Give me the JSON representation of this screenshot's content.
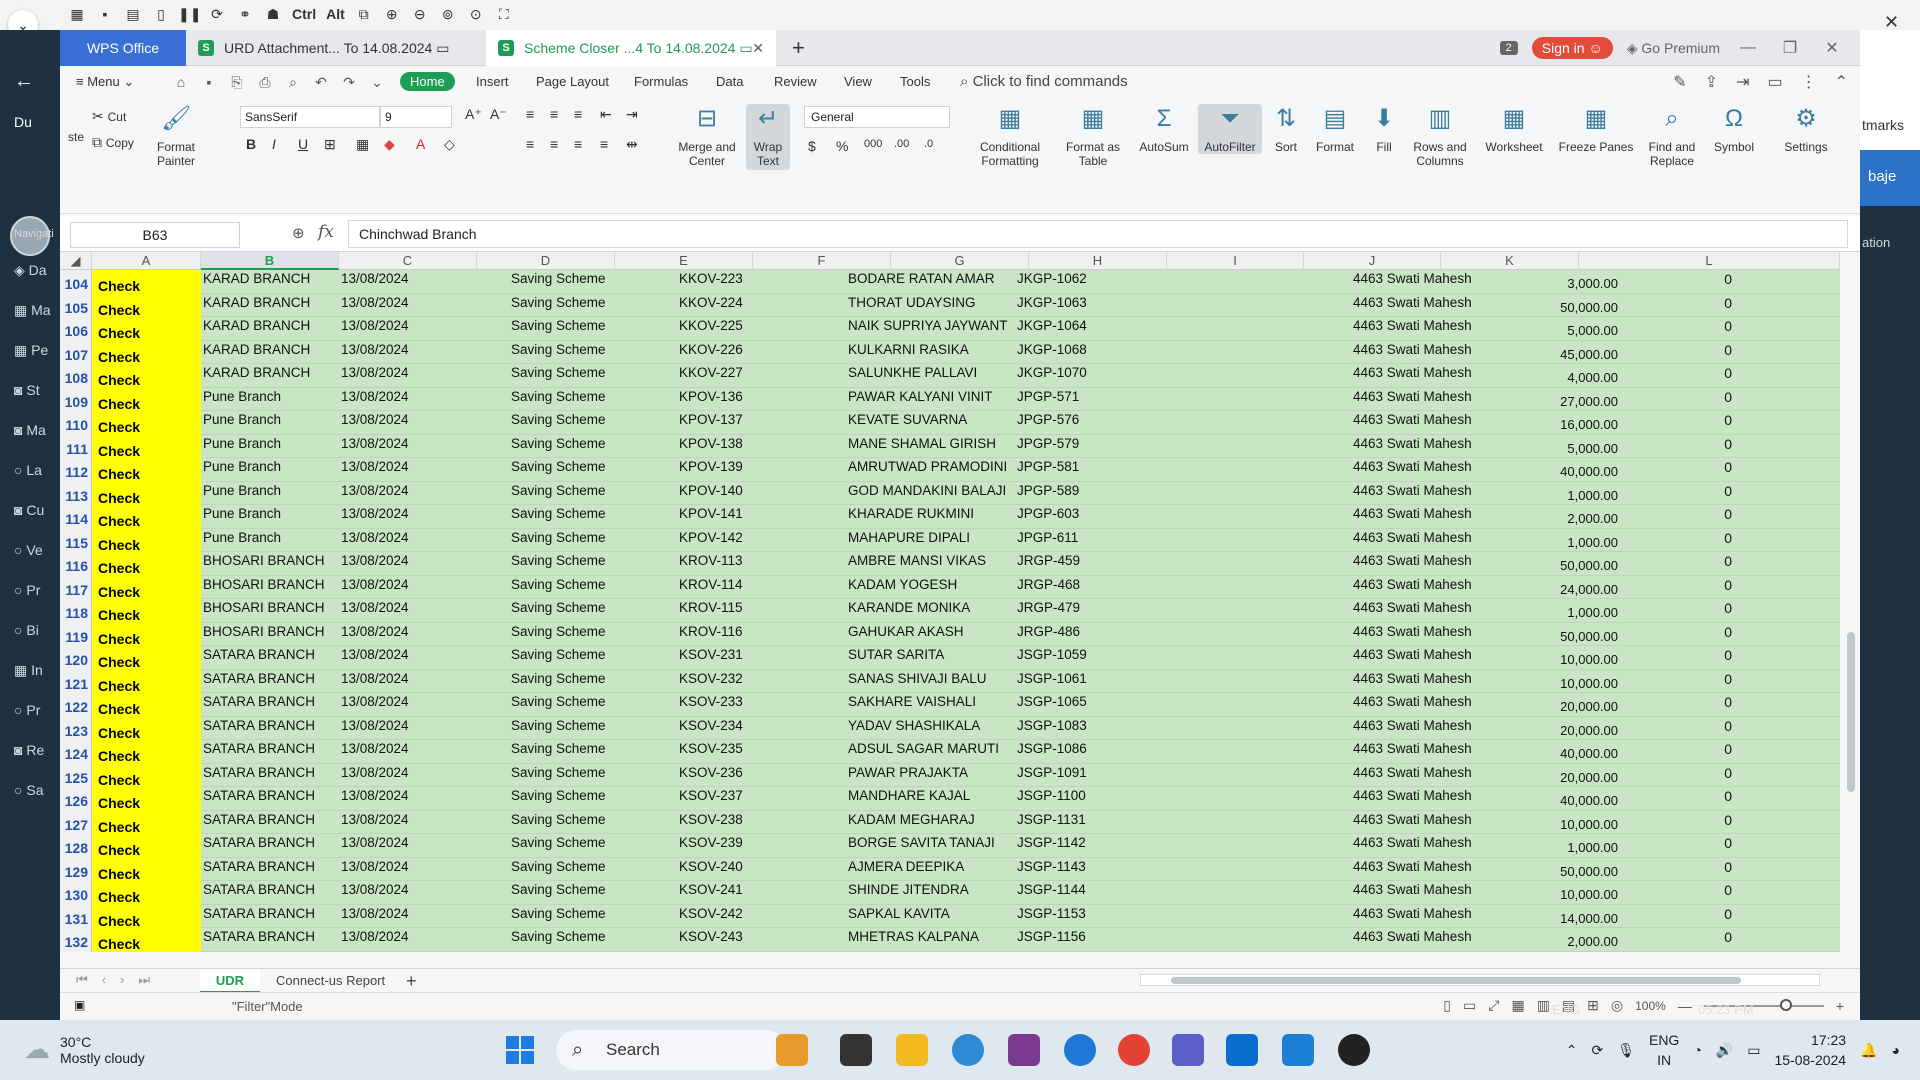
{
  "remote_toolbar": {
    "ctrl_label": "Ctrl",
    "alt_label": "Alt"
  },
  "app": {
    "wps_tab": "WPS Office",
    "doc_tabs": [
      {
        "label": "URD Attachment... To 14.08.2024",
        "icon": "S"
      },
      {
        "label": "Scheme  Closer ...4 To 14.08.2024",
        "icon": "S"
      }
    ],
    "badge_count": "2",
    "sign_in": "Sign in",
    "go_premium": "Go Premium"
  },
  "menu": {
    "menu_label": "Menu",
    "tabs": [
      "Home",
      "Insert",
      "Page Layout",
      "Formulas",
      "Data",
      "Review",
      "View",
      "Tools"
    ],
    "search_placeholder": "Click to find commands"
  },
  "ribbon": {
    "paste": "ste",
    "cut": "Cut",
    "copy": "Copy",
    "format_painter": [
      "Format",
      "Painter"
    ],
    "font_name": "SansSerif",
    "font_size": "9",
    "merge_center": [
      "Merge and",
      "Center"
    ],
    "wrap_text": [
      "Wrap",
      "Text"
    ],
    "number_format": "General",
    "conditional_formatting": [
      "Conditional",
      "Formatting"
    ],
    "format_as_table": [
      "Format as",
      "Table"
    ],
    "autosum": "AutoSum",
    "autofilter": "AutoFilter",
    "sort": "Sort",
    "format": "Format",
    "fill": "Fill",
    "rows_columns": [
      "Rows and",
      "Columns"
    ],
    "worksheet": "Worksheet",
    "freeze_panes": "Freeze Panes",
    "find_replace": [
      "Find and",
      "Replace"
    ],
    "symbol": "Symbol",
    "settings": "Settings"
  },
  "formula_bar": {
    "name_box": "B63",
    "fx": "fx",
    "value": "Chinchwad Branch"
  },
  "columns": [
    "A",
    "B",
    "C",
    "D",
    "E",
    "F",
    "G",
    "H",
    "I",
    "J",
    "K",
    "L"
  ],
  "rows": [
    {
      "n": "104",
      "a": "Check",
      "b": "KARAD BRANCH",
      "c": "13/08/2024",
      "d": "Saving Scheme",
      "e": "KKOV-223",
      "f": "BODARE RATAN AMAR",
      "g": "JKGP-1062",
      "i": "4463 Swati Mahesh",
      "j": "3,000.00",
      "k": "0"
    },
    {
      "n": "105",
      "a": "Check",
      "b": "KARAD BRANCH",
      "c": "13/08/2024",
      "d": "Saving Scheme",
      "e": "KKOV-224",
      "f": "THORAT UDAYSING",
      "g": "JKGP-1063",
      "i": "4463 Swati Mahesh",
      "j": "50,000.00",
      "k": "0"
    },
    {
      "n": "106",
      "a": "Check",
      "b": "KARAD BRANCH",
      "c": "13/08/2024",
      "d": "Saving Scheme",
      "e": "KKOV-225",
      "f": "NAIK SUPRIYA JAYWANT",
      "g": "JKGP-1064",
      "i": "4463 Swati Mahesh",
      "j": "5,000.00",
      "k": "0"
    },
    {
      "n": "107",
      "a": "Check",
      "b": "KARAD BRANCH",
      "c": "13/08/2024",
      "d": "Saving Scheme",
      "e": "KKOV-226",
      "f": "KULKARNI RASIKA",
      "g": "JKGP-1068",
      "i": "4463 Swati Mahesh",
      "j": "45,000.00",
      "k": "0"
    },
    {
      "n": "108",
      "a": "Check",
      "b": "KARAD BRANCH",
      "c": "13/08/2024",
      "d": "Saving Scheme",
      "e": "KKOV-227",
      "f": "SALUNKHE PALLAVI",
      "g": "JKGP-1070",
      "i": "4463 Swati Mahesh",
      "j": "4,000.00",
      "k": "0"
    },
    {
      "n": "109",
      "a": "Check",
      "b": "Pune Branch",
      "c": "13/08/2024",
      "d": "Saving Scheme",
      "e": "KPOV-136",
      "f": "PAWAR KALYANI VINIT",
      "g": "JPGP-571",
      "i": "4463 Swati Mahesh",
      "j": "27,000.00",
      "k": "0"
    },
    {
      "n": "110",
      "a": "Check",
      "b": "Pune Branch",
      "c": "13/08/2024",
      "d": "Saving Scheme",
      "e": "KPOV-137",
      "f": "KEVATE SUVARNA",
      "g": "JPGP-576",
      "i": "4463 Swati Mahesh",
      "j": "16,000.00",
      "k": "0"
    },
    {
      "n": "111",
      "a": "Check",
      "b": "Pune Branch",
      "c": "13/08/2024",
      "d": "Saving Scheme",
      "e": "KPOV-138",
      "f": "MANE SHAMAL GIRISH",
      "g": "JPGP-579",
      "i": "4463 Swati Mahesh",
      "j": "5,000.00",
      "k": "0"
    },
    {
      "n": "112",
      "a": "Check",
      "b": "Pune Branch",
      "c": "13/08/2024",
      "d": "Saving Scheme",
      "e": "KPOV-139",
      "f": "AMRUTWAD PRAMODINI",
      "g": "JPGP-581",
      "i": "4463 Swati Mahesh",
      "j": "40,000.00",
      "k": "0"
    },
    {
      "n": "113",
      "a": "Check",
      "b": "Pune Branch",
      "c": "13/08/2024",
      "d": "Saving Scheme",
      "e": "KPOV-140",
      "f": "GOD MANDAKINI BALAJI",
      "g": "JPGP-589",
      "i": "4463 Swati Mahesh",
      "j": "1,000.00",
      "k": "0"
    },
    {
      "n": "114",
      "a": "Check",
      "b": "Pune Branch",
      "c": "13/08/2024",
      "d": "Saving Scheme",
      "e": "KPOV-141",
      "f": "KHARADE RUKMINI",
      "g": "JPGP-603",
      "i": "4463 Swati Mahesh",
      "j": "2,000.00",
      "k": "0"
    },
    {
      "n": "115",
      "a": "Check",
      "b": "Pune Branch",
      "c": "13/08/2024",
      "d": "Saving Scheme",
      "e": "KPOV-142",
      "f": "MAHAPURE DIPALI",
      "g": "JPGP-611",
      "i": "4463 Swati Mahesh",
      "j": "1,000.00",
      "k": "0"
    },
    {
      "n": "116",
      "a": "Check",
      "b": "BHOSARI BRANCH",
      "c": "13/08/2024",
      "d": "Saving Scheme",
      "e": "KROV-113",
      "f": "AMBRE MANSI VIKAS",
      "g": "JRGP-459",
      "i": "4463 Swati Mahesh",
      "j": "50,000.00",
      "k": "0"
    },
    {
      "n": "117",
      "a": "Check",
      "b": "BHOSARI BRANCH",
      "c": "13/08/2024",
      "d": "Saving Scheme",
      "e": "KROV-114",
      "f": "KADAM YOGESH",
      "g": "JRGP-468",
      "i": "4463 Swati Mahesh",
      "j": "24,000.00",
      "k": "0"
    },
    {
      "n": "118",
      "a": "Check",
      "b": "BHOSARI BRANCH",
      "c": "13/08/2024",
      "d": "Saving Scheme",
      "e": "KROV-115",
      "f": "KARANDE MONIKA",
      "g": "JRGP-479",
      "i": "4463 Swati Mahesh",
      "j": "1,000.00",
      "k": "0"
    },
    {
      "n": "119",
      "a": "Check",
      "b": "BHOSARI BRANCH",
      "c": "13/08/2024",
      "d": "Saving Scheme",
      "e": "KROV-116",
      "f": "GAHUKAR AKASH",
      "g": "JRGP-486",
      "i": "4463 Swati Mahesh",
      "j": "50,000.00",
      "k": "0"
    },
    {
      "n": "120",
      "a": "Check",
      "b": "SATARA BRANCH",
      "c": "13/08/2024",
      "d": "Saving Scheme",
      "e": "KSOV-231",
      "f": "SUTAR SARITA",
      "g": "JSGP-1059",
      "i": "4463 Swati Mahesh",
      "j": "10,000.00",
      "k": "0"
    },
    {
      "n": "121",
      "a": "Check",
      "b": "SATARA BRANCH",
      "c": "13/08/2024",
      "d": "Saving Scheme",
      "e": "KSOV-232",
      "f": "SANAS SHIVAJI BALU",
      "g": "JSGP-1061",
      "i": "4463 Swati Mahesh",
      "j": "10,000.00",
      "k": "0"
    },
    {
      "n": "122",
      "a": "Check",
      "b": "SATARA BRANCH",
      "c": "13/08/2024",
      "d": "Saving Scheme",
      "e": "KSOV-233",
      "f": "SAKHARE VAISHALI",
      "g": "JSGP-1065",
      "i": "4463 Swati Mahesh",
      "j": "20,000.00",
      "k": "0"
    },
    {
      "n": "123",
      "a": "Check",
      "b": "SATARA BRANCH",
      "c": "13/08/2024",
      "d": "Saving Scheme",
      "e": "KSOV-234",
      "f": "YADAV SHASHIKALA",
      "g": "JSGP-1083",
      "i": "4463 Swati Mahesh",
      "j": "20,000.00",
      "k": "0"
    },
    {
      "n": "124",
      "a": "Check",
      "b": "SATARA BRANCH",
      "c": "13/08/2024",
      "d": "Saving Scheme",
      "e": "KSOV-235",
      "f": "ADSUL SAGAR MARUTI",
      "g": "JSGP-1086",
      "i": "4463 Swati Mahesh",
      "j": "40,000.00",
      "k": "0"
    },
    {
      "n": "125",
      "a": "Check",
      "b": "SATARA BRANCH",
      "c": "13/08/2024",
      "d": "Saving Scheme",
      "e": "KSOV-236",
      "f": "PAWAR PRAJAKTA",
      "g": "JSGP-1091",
      "i": "4463 Swati Mahesh",
      "j": "20,000.00",
      "k": "0"
    },
    {
      "n": "126",
      "a": "Check",
      "b": "SATARA BRANCH",
      "c": "13/08/2024",
      "d": "Saving Scheme",
      "e": "KSOV-237",
      "f": "MANDHARE KAJAL",
      "g": "JSGP-1100",
      "i": "4463 Swati Mahesh",
      "j": "40,000.00",
      "k": "0"
    },
    {
      "n": "127",
      "a": "Check",
      "b": "SATARA BRANCH",
      "c": "13/08/2024",
      "d": "Saving Scheme",
      "e": "KSOV-238",
      "f": "KADAM MEGHARAJ",
      "g": "JSGP-1131",
      "i": "4463 Swati Mahesh",
      "j": "10,000.00",
      "k": "0"
    },
    {
      "n": "128",
      "a": "Check",
      "b": "SATARA BRANCH",
      "c": "13/08/2024",
      "d": "Saving Scheme",
      "e": "KSOV-239",
      "f": "BORGE SAVITA TANAJI",
      "g": "JSGP-1142",
      "i": "4463 Swati Mahesh",
      "j": "1,000.00",
      "k": "0"
    },
    {
      "n": "129",
      "a": "Check",
      "b": "SATARA BRANCH",
      "c": "13/08/2024",
      "d": "Saving Scheme",
      "e": "KSOV-240",
      "f": "AJMERA DEEPIKA",
      "g": "JSGP-1143",
      "i": "4463 Swati Mahesh",
      "j": "50,000.00",
      "k": "0"
    },
    {
      "n": "130",
      "a": "Check",
      "b": "SATARA BRANCH",
      "c": "13/08/2024",
      "d": "Saving Scheme",
      "e": "KSOV-241",
      "f": "SHINDE JITENDRA",
      "g": "JSGP-1144",
      "i": "4463 Swati Mahesh",
      "j": "10,000.00",
      "k": "0"
    },
    {
      "n": "131",
      "a": "Check",
      "b": "SATARA BRANCH",
      "c": "13/08/2024",
      "d": "Saving Scheme",
      "e": "KSOV-242",
      "f": "SAPKAL KAVITA",
      "g": "JSGP-1153",
      "i": "4463 Swati Mahesh",
      "j": "14,000.00",
      "k": "0"
    },
    {
      "n": "132",
      "a": "Check",
      "b": "SATARA BRANCH",
      "c": "13/08/2024",
      "d": "Saving Scheme",
      "e": "KSOV-243",
      "f": "MHETRAS KALPANA",
      "g": "JSGP-1156",
      "i": "4463 Swati Mahesh",
      "j": "2,000.00",
      "k": "0"
    }
  ],
  "sheets": {
    "active": "UDR",
    "other": "Connect-us Report"
  },
  "status": {
    "mode": "\"Filter\"Mode",
    "zoom": "100%"
  },
  "side_left": {
    "du": "Du",
    "nav": [
      "Da",
      "Ma",
      "Pe",
      "St",
      "Ma",
      "La",
      "Cu",
      "Ve",
      "Pr",
      "Bi",
      "In",
      "Pr",
      "Re",
      "Sa"
    ],
    "navig": "Navigati"
  },
  "side_right": {
    "marks": "tmarks",
    "baje": "baje",
    "ation": "ation"
  },
  "taskbar": {
    "temp": "30°C",
    "weather": "Mostly cloudy",
    "search": "Search",
    "lang_top": "ENG",
    "lang_bottom": "IN",
    "time": "17:23",
    "date": "15-08-2024",
    "remote_time": "05:23 PM",
    "remote_lang": "ENG"
  },
  "colors": {
    "accent": "#1f9d55",
    "wps_blue": "#3a6fd8",
    "check_yellow": "#ffff00",
    "row_green": "#c8e6c3"
  }
}
